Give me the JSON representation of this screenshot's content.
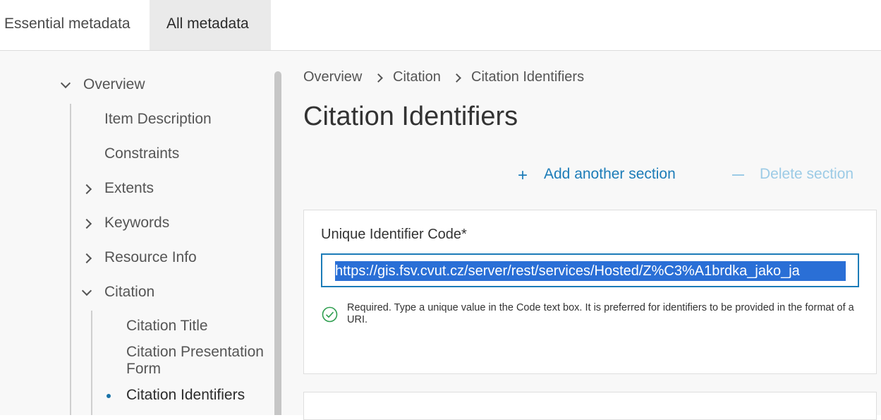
{
  "tabs": {
    "essential": "Essential metadata",
    "all": "All metadata"
  },
  "sidebar": {
    "items": [
      {
        "label": "Overview",
        "expander": "chevron-down"
      },
      {
        "label": "Item Description"
      },
      {
        "label": "Constraints"
      },
      {
        "label": "Extents",
        "expander": "chevron-right"
      },
      {
        "label": "Keywords",
        "expander": "chevron-right"
      },
      {
        "label": "Resource Info",
        "expander": "chevron-right"
      },
      {
        "label": "Citation",
        "expander": "chevron-down"
      },
      {
        "label": "Citation Title"
      },
      {
        "label": "Citation Presentation Form"
      },
      {
        "label": "Citation Identifiers",
        "selected": true
      }
    ]
  },
  "breadcrumb": {
    "items": [
      "Overview",
      "Citation",
      "Citation Identifiers"
    ]
  },
  "page": {
    "title": "Citation Identifiers"
  },
  "actions": {
    "add_label": "Add another section",
    "delete_label": "Delete section"
  },
  "form": {
    "code_label": "Unique Identifier Code*",
    "code_value": "https://gis.fsv.cvut.cz/server/rest/services/Hosted/Z%C3%A1brdka_jako_ja",
    "hint": "Required. Type a unique value in the Code text box. It is preferred for identifiers to be provided in the format of a URI."
  },
  "colors": {
    "accent": "#1c7cb8",
    "selection": "#2a6fd6",
    "valid": "#2e9e4f"
  }
}
